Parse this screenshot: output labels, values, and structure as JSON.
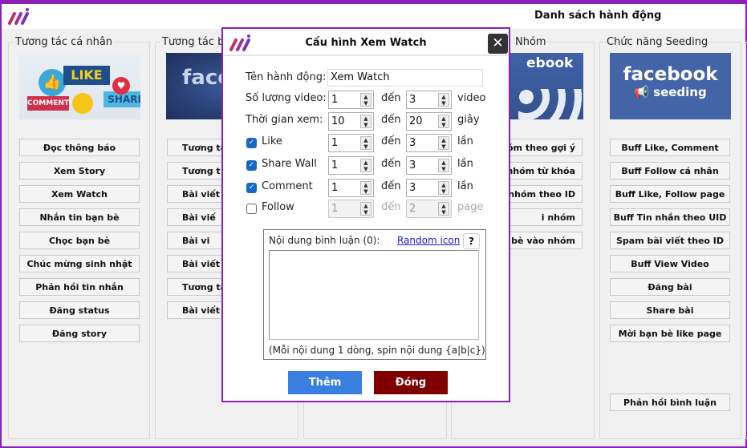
{
  "app": {
    "title": "Danh sách hành động"
  },
  "groups": [
    {
      "label": "Tương tác cá nhân",
      "image_text": [
        "LIKE",
        "COMMENT",
        "SHARE"
      ],
      "buttons": [
        "Đọc thông báo",
        "Xem Story",
        "Xem Watch",
        "Nhắn tin bạn bè",
        "Chọc bạn bè",
        "Chúc mừng sinh nhật",
        "Phản hồi tin nhắn",
        "Đăng status",
        "Đăng story"
      ]
    },
    {
      "label": "Tương tác bà",
      "image_text": "face",
      "buttons": [
        "Tương tá",
        "Tương t",
        "Bài viết",
        "Bài viế",
        "Bài vi",
        "Bài viết",
        "Tương tác b",
        "Bài viết"
      ]
    },
    {
      "label": "Nhóm",
      "image_text": "ebook",
      "buttons": [
        "hóm theo gợi ý",
        "nhóm từ khóa",
        "nhóm theo ID",
        "i nhóm",
        "bè vào nhóm"
      ]
    },
    {
      "label": "Chức năng Seeding",
      "image_text": [
        "facebook",
        "seeding"
      ],
      "buttons": [
        "Buff Like, Comment",
        "Buff Follow cá nhân",
        "Buff Like, Follow page",
        "Buff Tin nhắn theo UID",
        "Spam bài viết theo ID",
        "Buff View Video",
        "Đăng bài",
        "Share bài",
        "Mời bạn bè like page"
      ],
      "bottom_button": "Phản hồi bình luận"
    }
  ],
  "dialog": {
    "title": "Cấu hình Xem Watch",
    "close_icon": "close-icon",
    "name_label": "Tên hành động:",
    "name_value": "Xem Watch",
    "to": "đến",
    "rows": [
      {
        "label": "Số lượng video:",
        "from": "1",
        "to": "3",
        "unit": "video"
      },
      {
        "label": "Thời gian xem:",
        "from": "10",
        "to": "20",
        "unit": "giây"
      },
      {
        "label": "Like",
        "checked": true,
        "from": "1",
        "to": "3",
        "unit": "lần"
      },
      {
        "label": "Share Wall",
        "checked": true,
        "from": "1",
        "to": "3",
        "unit": "lần"
      },
      {
        "label": "Comment",
        "checked": true,
        "from": "1",
        "to": "3",
        "unit": "lần"
      },
      {
        "label": "Follow",
        "checked": false,
        "from": "1",
        "to": "2",
        "unit": "page"
      }
    ],
    "comment_label": "Nội dung bình luận (0):",
    "random_icon": "Random icon",
    "help": "?",
    "comment_value": "",
    "hint": "(Mỗi nội dung 1 dòng, spin nội dung {a|b|c})",
    "add_button": "Thêm",
    "close_button": "Đóng",
    "colors": {
      "accent": "#8b1fb8",
      "add": "#3a7fe0",
      "close": "#800000"
    }
  }
}
